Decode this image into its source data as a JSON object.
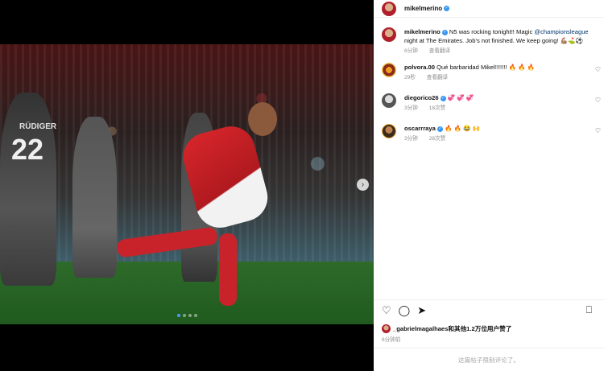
{
  "post": {
    "author": "mikelmerino",
    "caption_author": "mikelmerino",
    "caption_line1": "N5 was rocking tonight!! Magic",
    "caption_mention": "@championsleague",
    "caption_line2": " night at The Emirates. Job's not finished. We keep going! 💪🏽⛳⚽",
    "caption_time": "6分钟",
    "translate_label": "查看翻译"
  },
  "photo": {
    "jersey_name": "RÜDIGER",
    "jersey_number": "22",
    "next_icon": "chevron-right-icon",
    "slide_count": 4,
    "active_slide": 1
  },
  "comments": [
    {
      "user": "polvora.00",
      "verified": false,
      "text": "Qué barbaridad Mikel!!!!!!! 🔥 🔥 🔥",
      "time": "29秒",
      "action": "查看翻译"
    },
    {
      "user": "diegorico26",
      "verified": true,
      "text": "💞 💞 💞",
      "time": "3分钟",
      "action": "18次赞"
    },
    {
      "user": "oscarrraya",
      "verified": true,
      "text": "🔥 🔥 😂 🙌",
      "time": "3分钟",
      "action": "28次赞"
    }
  ],
  "actions": {
    "like_icon": "heart-icon",
    "comment_icon": "comment-icon",
    "share_icon": "send-icon",
    "save_icon": "bookmark-icon"
  },
  "likes": {
    "user": "_gabrielmagalhaes",
    "rest": "和其他1.2万位用户赞了"
  },
  "post_time": "6分钟前",
  "comments_restricted": "这篇帖子限制评论了。",
  "colors": {
    "verified": "#3897f0",
    "mention": "#00376b",
    "muted": "#8e8e8e"
  }
}
